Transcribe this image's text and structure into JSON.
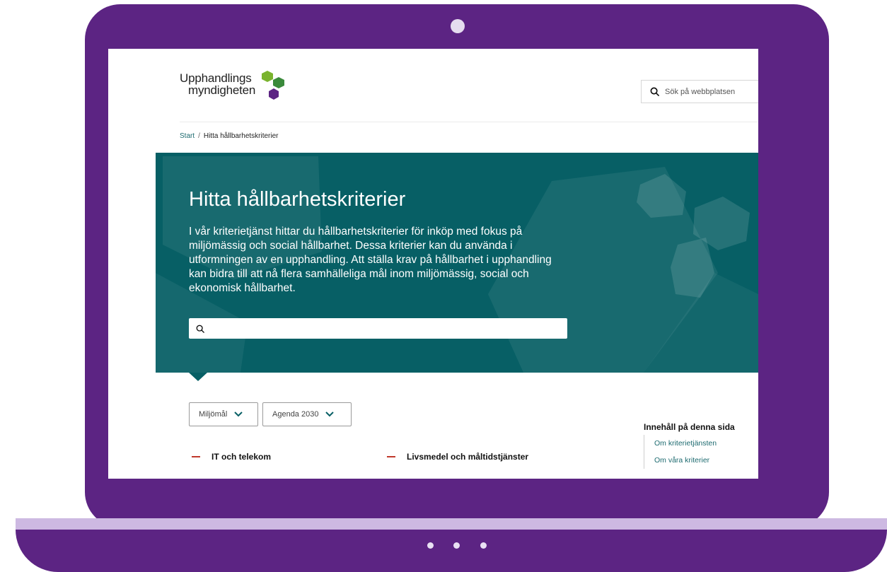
{
  "site": {
    "logo_line1": "Upphandlings",
    "logo_line2": "myndigheten",
    "search_placeholder": "Sök på webbplatsen"
  },
  "breadcrumb": {
    "start": "Start",
    "separator": "/",
    "current": "Hitta hållbarhetskriterier"
  },
  "hero": {
    "title": "Hitta hållbarhetskriterier",
    "text": "I vår kriterietjänst hittar du hållbarhetskriterier för inköp med fokus på miljömässig och social hållbarhet. Dessa kriterier kan du använda i utformningen av en upphandling. Att ställa krav på hållbarhet i upphandling kan bidra till att nå flera samhälleliga mål inom miljömässig, social och ekonomisk hållbarhet.",
    "search_value": ""
  },
  "filters": [
    {
      "label": "Miljömål"
    },
    {
      "label": "Agenda 2030"
    }
  ],
  "categories": [
    {
      "label": "IT och telekom"
    },
    {
      "label": "Livsmedel och måltidstjänster"
    }
  ],
  "toc": {
    "heading": "Innehåll på denna sida",
    "items": [
      "Om kriterietjänsten",
      "Om våra kriterier"
    ]
  },
  "colors": {
    "frame": "#5c2483",
    "hero_bg": "#075f65",
    "link": "#1e6b70",
    "logo_green_light": "#7ab32e",
    "logo_green_dark": "#3a8a3b",
    "logo_purple": "#5c2483"
  },
  "icons": {
    "site_search": "search-icon",
    "hero_search": "search-icon",
    "filter": "chevron-down-icon",
    "category": "minus-icon"
  }
}
